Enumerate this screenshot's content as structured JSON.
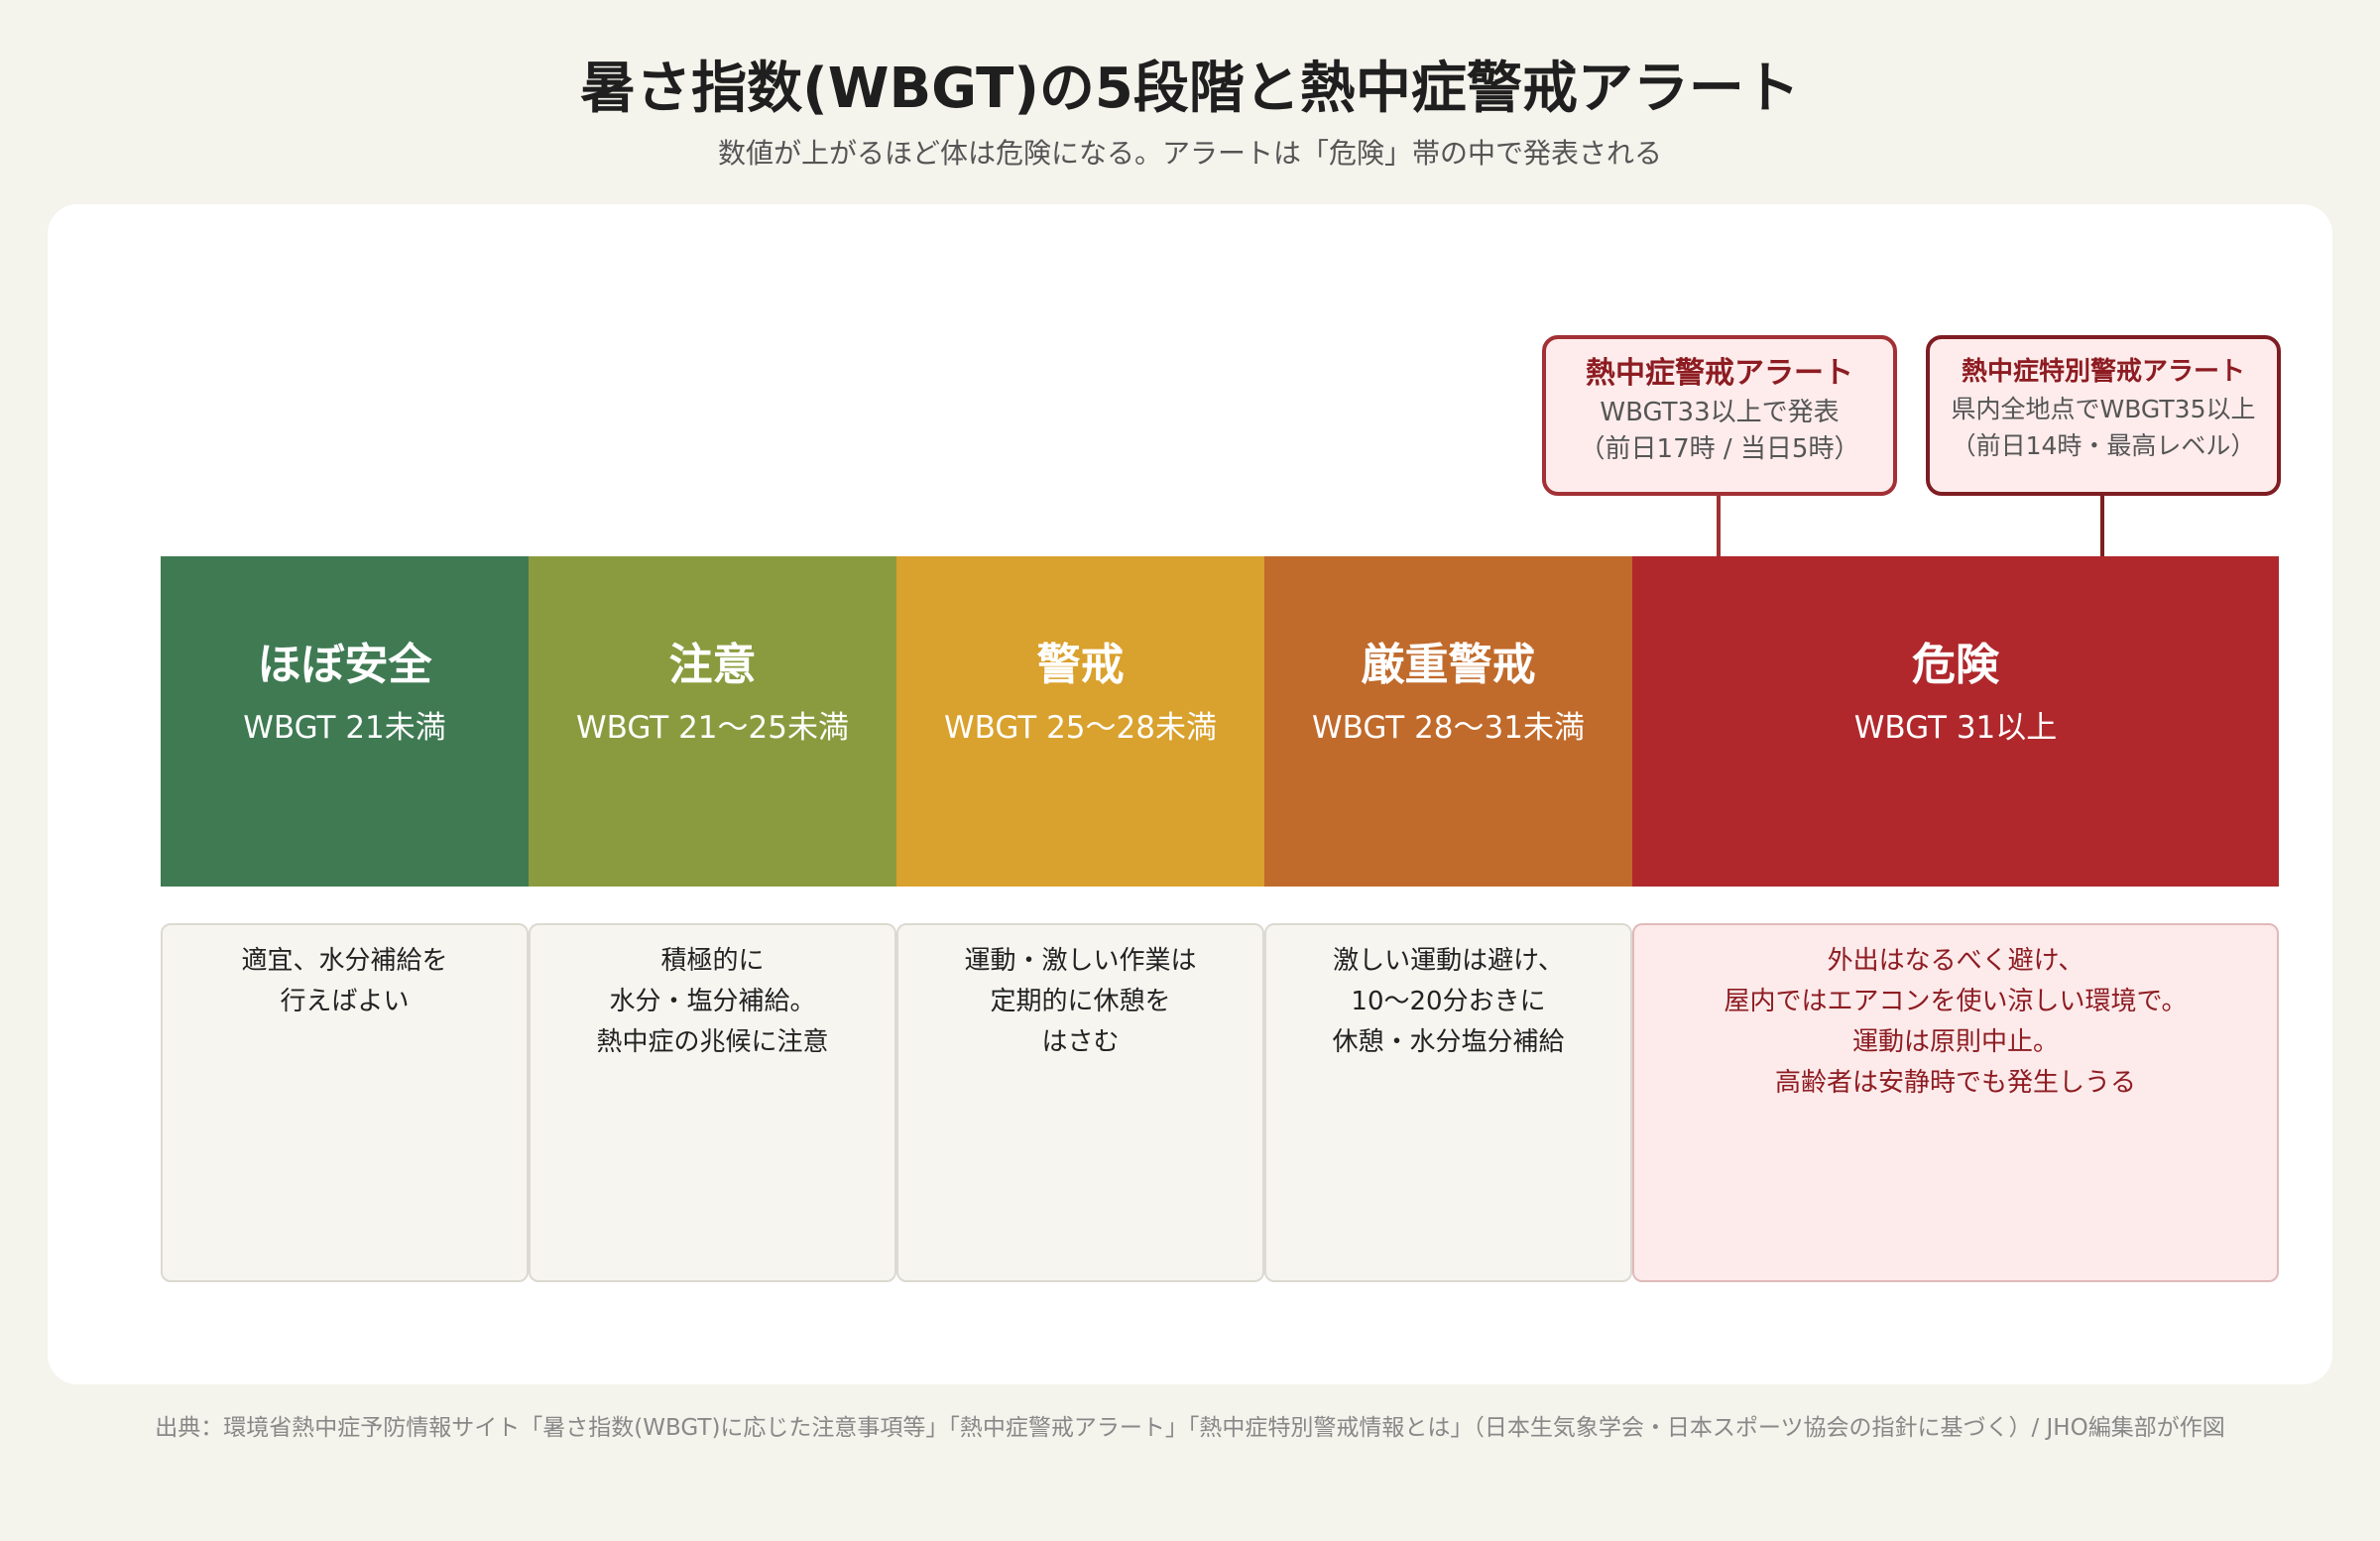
{
  "header": {
    "title": "暑さ指数(WBGT)の5段階と熱中症警戒アラート",
    "subtitle": "数値が上がるほど体は危険になる。アラートは「危険」帯の中で発表される"
  },
  "alerts": [
    {
      "title": "熱中症警戒アラート",
      "line1": "WBGT33以上で発表",
      "line2": "（前日17時 / 当日5時）"
    },
    {
      "title": "熱中症特別警戒アラート",
      "line1": "県内全地点でWBGT35以上",
      "line2": "（前日14時・最高レベル）"
    }
  ],
  "levels": [
    {
      "label": "ほぼ安全",
      "range": "WBGT 21未満",
      "color": "#3f7a53",
      "desc": [
        "適宜、水分補給を",
        "行えばよい"
      ]
    },
    {
      "label": "注意",
      "range": "WBGT 21〜25未満",
      "color": "#8a9b3f",
      "desc": [
        "積極的に",
        "水分・塩分補給。",
        "熱中症の兆候に注意"
      ]
    },
    {
      "label": "警戒",
      "range": "WBGT 25〜28未満",
      "color": "#d9a12d",
      "desc": [
        "運動・激しい作業は",
        "定期的に休憩を",
        "はさむ"
      ]
    },
    {
      "label": "厳重警戒",
      "range": "WBGT 28〜31未満",
      "color": "#c06a2b",
      "desc": [
        "激しい運動は避け、",
        "10〜20分おきに",
        "休憩・水分塩分補給"
      ]
    },
    {
      "label": "危険",
      "range": "WBGT 31以上",
      "color": "#b0282c",
      "desc": [
        "外出はなるべく避け、",
        "屋内ではエアコンを使い涼しい環境で。",
        "運動は原則中止。",
        "高齢者は安静時でも発生しうる"
      ]
    }
  ],
  "source": "出典：環境省熱中症予防情報サイト「暑さ指数(WBGT)に応じた注意事項等」「熱中症警戒アラート」「熱中症特別警戒情報とは」（日本生気象学会・日本スポーツ協会の指針に基づく）/ JHO編集部が作図"
}
